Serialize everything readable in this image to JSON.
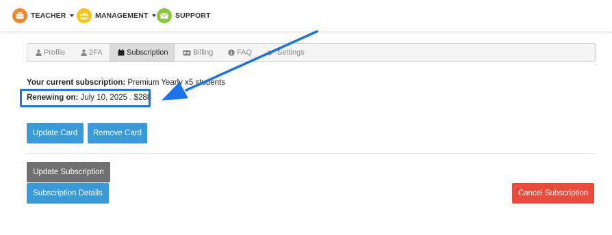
{
  "nav": {
    "items": [
      {
        "label": "TEACHER",
        "icon": "briefcase-icon",
        "color": "#f08a24",
        "has_caret": true
      },
      {
        "label": "MANAGEMENT",
        "icon": "users-icon",
        "color": "#f5c518",
        "has_caret": true
      },
      {
        "label": "SUPPORT",
        "icon": "mail-icon",
        "color": "#8cc63f",
        "has_caret": false
      }
    ]
  },
  "tabs": [
    {
      "label": "Profile",
      "icon": "user-icon",
      "active": false
    },
    {
      "label": "2FA",
      "icon": "user-icon",
      "active": false
    },
    {
      "label": "Subscription",
      "icon": "calendar-icon",
      "active": true
    },
    {
      "label": "Billing",
      "icon": "card-icon",
      "active": false
    },
    {
      "label": "FAQ",
      "icon": "info-icon",
      "active": false
    },
    {
      "label": "Settings",
      "icon": "gears-icon",
      "active": false
    }
  ],
  "subscription": {
    "current_label": "Your current subscription:",
    "current_value": " Premium Yearly x5 students",
    "renewing_label": "Renewing on:",
    "renewing_value": " July 10, 2025 . $288"
  },
  "buttons": {
    "update_card": "Update Card",
    "remove_card": "Remove Card",
    "update_subscription": "Update Subscription",
    "subscription_details": "Subscription Details",
    "cancel_subscription": "Cancel Subscription"
  },
  "colors": {
    "accent_blue": "#3a99d8",
    "danger_red": "#e74c3c",
    "highlight_blue": "#1a73e8"
  }
}
